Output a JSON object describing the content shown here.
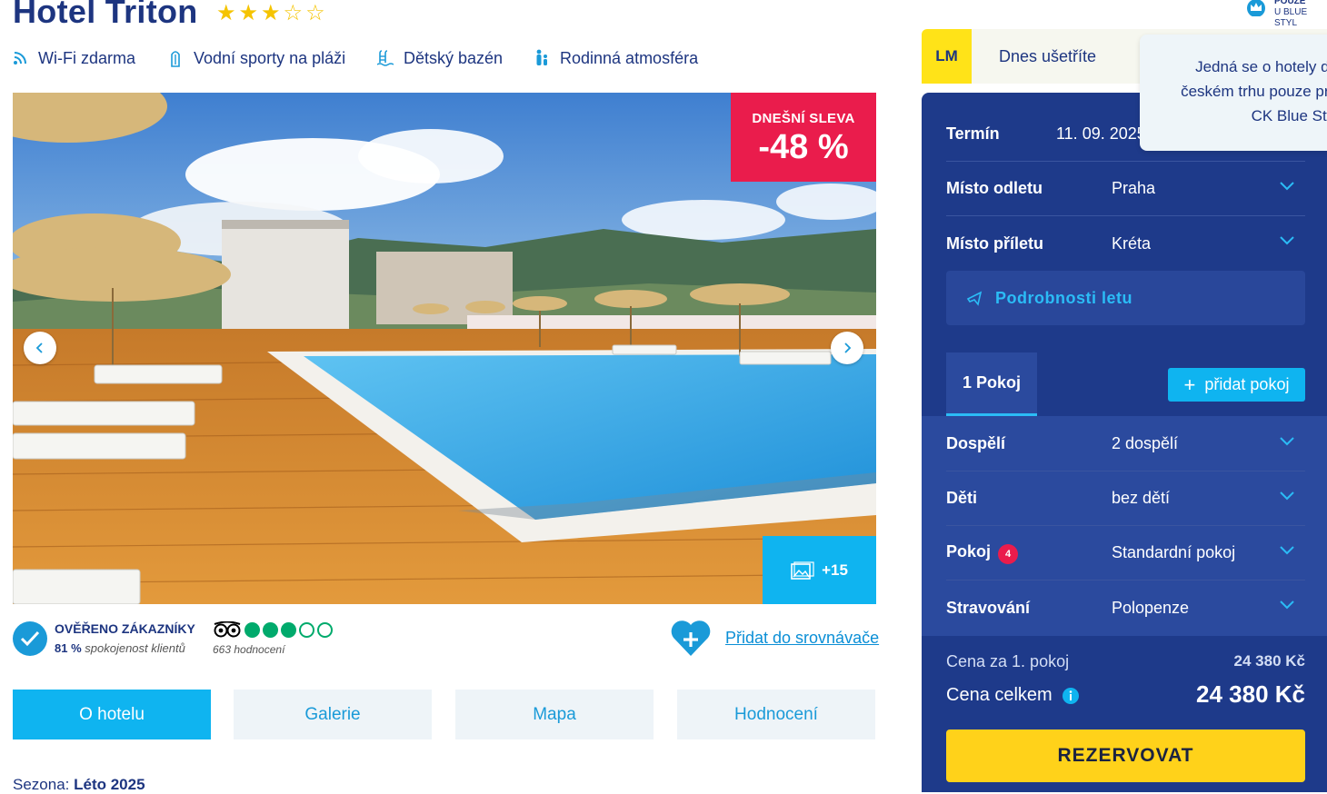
{
  "hotel": {
    "name": "Hotel Triton",
    "stars": 3,
    "max_stars": 5,
    "star_glyphs": "★★★☆☆"
  },
  "features": [
    {
      "label": "Wi-Fi zdarma",
      "icon": "wifi-icon"
    },
    {
      "label": "Vodní sporty na pláži",
      "icon": "surfboard-icon"
    },
    {
      "label": "Dětský bazén",
      "icon": "pool-ladder-icon"
    },
    {
      "label": "Rodinná atmosféra",
      "icon": "family-icon"
    }
  ],
  "gallery": {
    "discount_label": "DNEŠNÍ SLEVA",
    "discount_value": "-48 %",
    "more_photos": "+15"
  },
  "verified": {
    "title": "OVĚŘENO ZÁKAZNÍKY",
    "percent": "81 %",
    "percent_text": "spokojenost klientů"
  },
  "tripadvisor": {
    "rating": 3,
    "max": 5,
    "count_text": "663 hodnocení"
  },
  "compare_link": "Přidat do srovnávače",
  "tabs": [
    {
      "label": "O hotelu",
      "active": true
    },
    {
      "label": "Galerie",
      "active": false
    },
    {
      "label": "Mapa",
      "active": false
    },
    {
      "label": "Hodnocení",
      "active": false
    }
  ],
  "season": {
    "label": "Sezona:",
    "value": "Léto 2025"
  },
  "lastminute": {
    "badge": "LM",
    "text": "Dnes ušetříte"
  },
  "tooltip": {
    "lines": [
      "Jedná se o hotely do",
      "českém trhu pouze pro",
      "CK Blue Styl"
    ]
  },
  "exclusive": {
    "line1": "POUZE",
    "line2": "U BLUE STYL"
  },
  "booking": {
    "term_label": "Termín",
    "term_value": "11. 09. 2025",
    "departure_label": "Místo odletu",
    "departure_value": "Praha",
    "arrival_label": "Místo příletu",
    "arrival_value": "Kréta",
    "flight_details": "Podrobnosti letu",
    "room_tab": "1 Pokoj",
    "add_room": "přidat pokoj",
    "adults_label": "Dospělí",
    "adults_value": "2 dospělí",
    "children_label": "Děti",
    "children_value": "bez dětí",
    "room_label": "Pokoj",
    "room_badge": "4",
    "room_value": "Standardní pokoj",
    "board_label": "Stravování",
    "board_value": "Polopenze",
    "price_room_label": "Cena za 1. pokoj",
    "price_room_value": "24 380 Kč",
    "price_total_label": "Cena celkem",
    "price_total_value": "24 380 Kč",
    "reserve_button": "REZERVOVAT"
  },
  "colors": {
    "brand_blue": "#1e3a8a",
    "accent_cyan": "#0fb4f0",
    "sale_red": "#ea1c4c",
    "cta_yellow": "#ffd21a"
  }
}
